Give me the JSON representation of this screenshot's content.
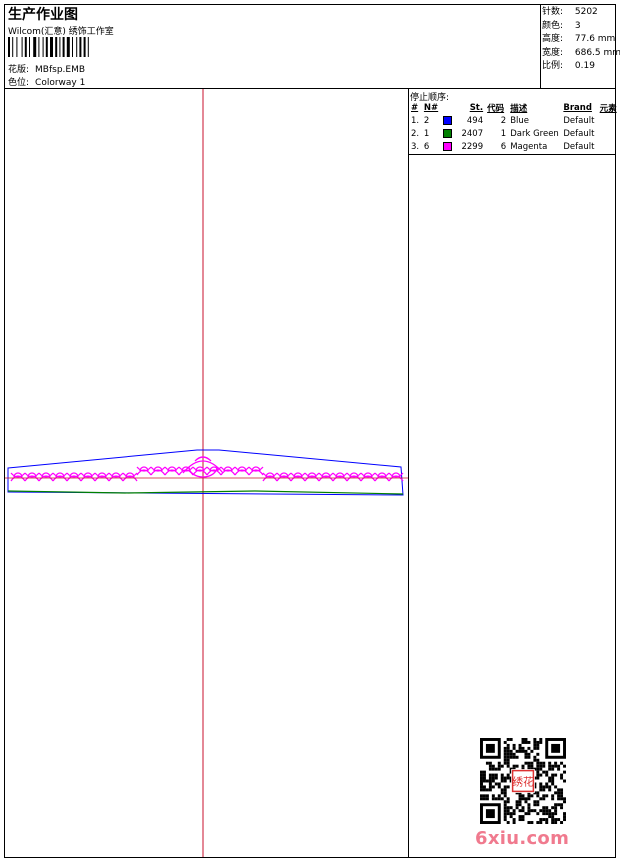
{
  "header": {
    "title": "生产作业图",
    "subtitle": "Wilcom(汇意) 绣饰工作室",
    "design_label": "花版:",
    "design_value": "MBfsp.EMB",
    "colorway_label": "色位:",
    "colorway_value": "Colorway 1"
  },
  "stats": [
    {
      "label": "针数:",
      "value": "5202"
    },
    {
      "label": "颜色:",
      "value": "3"
    },
    {
      "label": "高度:",
      "value": "77.6 mm"
    },
    {
      "label": "宽度:",
      "value": "686.5 mm"
    },
    {
      "label": "比例:",
      "value": "0.19"
    }
  ],
  "stop_sequence": {
    "title": "停止顺序:",
    "headers": [
      "#",
      "N#",
      "",
      "St.",
      "代码",
      "描述",
      "Brand",
      "元素"
    ],
    "rows": [
      {
        "index": "1.",
        "n": "2",
        "color": "#0000ff",
        "stitches": "494",
        "code": "2",
        "description": "Blue",
        "brand": "Default"
      },
      {
        "index": "2.",
        "n": "1",
        "color": "#008000",
        "stitches": "2407",
        "code": "1",
        "description": "Dark Green",
        "brand": "Default"
      },
      {
        "index": "3.",
        "n": "6",
        "color": "#ff00ff",
        "stitches": "2299",
        "code": "6",
        "description": "Magenta",
        "brand": "Default"
      }
    ]
  },
  "watermark": {
    "text": "6xiu.com",
    "seal": "绣花"
  }
}
